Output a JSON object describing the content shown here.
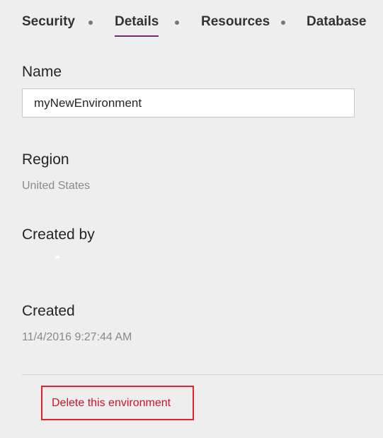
{
  "tabs": [
    {
      "label": "Security",
      "active": false
    },
    {
      "label": "Details",
      "active": true
    },
    {
      "label": "Resources",
      "active": false
    },
    {
      "label": "Database",
      "active": false
    }
  ],
  "details": {
    "name_label": "Name",
    "name_value": "myNewEnvironment",
    "region_label": "Region",
    "region_value": "United States",
    "created_by_label": "Created by",
    "created_label": "Created",
    "created_value": "11/4/2016 9:27:44 AM"
  },
  "actions": {
    "delete_label": "Delete this environment"
  },
  "colors": {
    "accent": "#742774",
    "danger": "#d0112b",
    "danger_border": "#e8202a",
    "background": "#efeeee"
  }
}
